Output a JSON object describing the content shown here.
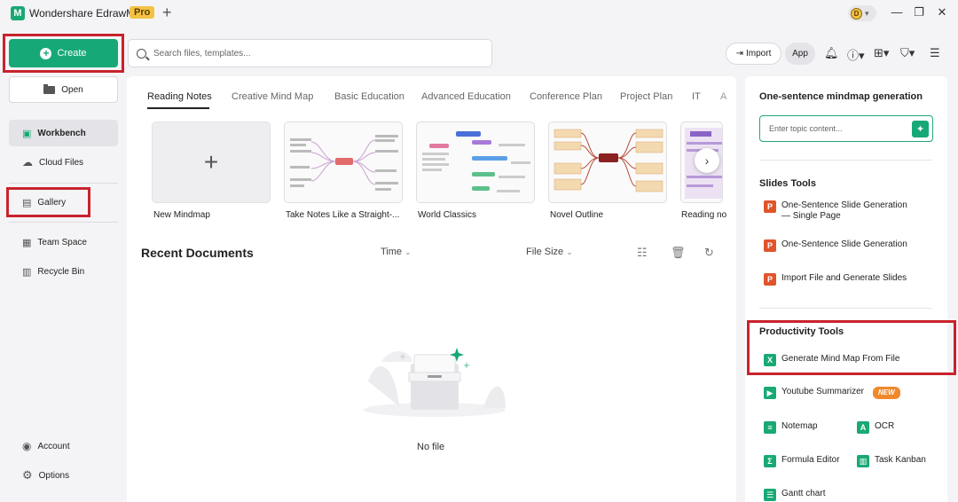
{
  "titlebar": {
    "app_title": "Wondershare EdrawMind",
    "badge": "Pro",
    "new_tab": "+",
    "avatar_letter": "D",
    "minimize": "—",
    "restore": "❐",
    "close": "✕"
  },
  "toolbar": {
    "create_label": "Create",
    "search_placeholder": "Search files, templates...",
    "import_label": "Import",
    "app_label": "App"
  },
  "sidebar": {
    "open_label": "Open",
    "items": [
      {
        "label": "Workbench"
      },
      {
        "label": "Cloud Files"
      },
      {
        "label": "Gallery"
      },
      {
        "label": "Team Space"
      },
      {
        "label": "Recycle Bin"
      },
      {
        "label": "Account"
      },
      {
        "label": "Options"
      }
    ]
  },
  "main": {
    "tabs": [
      {
        "label": "Reading Notes"
      },
      {
        "label": "Creative Mind Map"
      },
      {
        "label": "Basic Education"
      },
      {
        "label": "Advanced Education"
      },
      {
        "label": "Conference Plan"
      },
      {
        "label": "Project Plan"
      },
      {
        "label": "IT"
      },
      {
        "label": "A"
      }
    ],
    "templates": [
      {
        "label": "New Mindmap"
      },
      {
        "label": "Take Notes Like a Straight-..."
      },
      {
        "label": "World Classics"
      },
      {
        "label": "Novel Outline"
      },
      {
        "label": "Reading no"
      }
    ],
    "recent_title": "Recent Documents",
    "sort_time": "Time",
    "sort_size": "File Size",
    "empty_text": "No file"
  },
  "right_panel": {
    "mindmap_gen_title": "One-sentence mindmap generation",
    "topic_placeholder": "Enter topic content...",
    "slides_title": "Slides Tools",
    "slides_items": [
      {
        "label": "One-Sentence Slide Generation — Single Page"
      },
      {
        "label": "One-Sentence Slide Generation"
      },
      {
        "label": "Import File and Generate Slides"
      }
    ],
    "productivity_title": "Productivity Tools",
    "productivity_items": [
      {
        "label": "Generate Mind Map From File"
      },
      {
        "label": "Youtube Summarizer",
        "badge": "NEW"
      },
      {
        "label": "Notemap"
      },
      {
        "label": "OCR"
      },
      {
        "label": "Formula Editor"
      },
      {
        "label": "Task Kanban"
      },
      {
        "label": "Gantt chart"
      }
    ]
  },
  "colors": {
    "accent": "#17a878",
    "highlight": "#c8232c",
    "pro_badge": "#f3c244"
  }
}
